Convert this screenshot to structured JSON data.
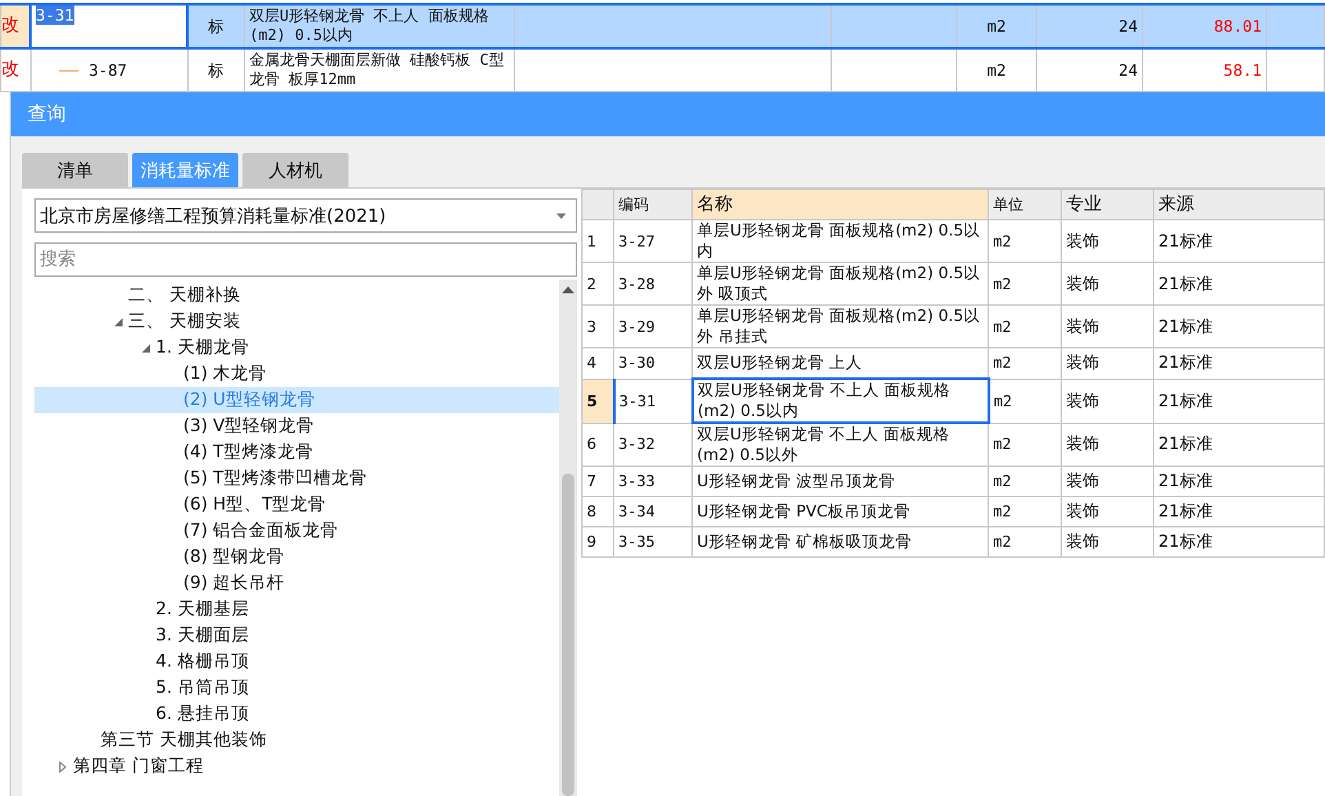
{
  "background_table": {
    "rows": [
      {
        "mark": "改",
        "code": "3-31",
        "type": "标",
        "name": "双层U形轻钢龙骨 不上人 面板规格(m2) 0.5以内",
        "unit": "m2",
        "quantity": "24",
        "price": "88.01",
        "selected": true
      },
      {
        "mark": "改",
        "code": "3-87",
        "type": "标",
        "name": "金属龙骨天棚面层新做 硅酸钙板 C型龙骨 板厚12mm",
        "unit": "m2",
        "quantity": "24",
        "price": "58.1",
        "selected": false
      }
    ]
  },
  "dialog": {
    "title": "查询",
    "tabs": [
      {
        "label": "清单",
        "selected": false
      },
      {
        "label": "消耗量标准",
        "selected": true
      },
      {
        "label": "人材机",
        "selected": false
      }
    ],
    "standard_dropdown": {
      "value": "北京市房屋修缮工程预算消耗量标准(2021)"
    },
    "search": {
      "placeholder": "搜索"
    },
    "tree": [
      {
        "children": [
          {
            "children": [
              {
                "label": "二、 天棚补换",
                "selected": false
              },
              {
                "label": "三、 天棚安装",
                "selected": false,
                "expanded": true,
                "children": [
                  {
                    "label": "1. 天棚龙骨",
                    "selected": false,
                    "expanded": true,
                    "children": [
                      {
                        "label": "(1) 木龙骨",
                        "selected": false
                      },
                      {
                        "label": "(2) U型轻钢龙骨",
                        "selected": true
                      },
                      {
                        "label": "(3) V型轻钢龙骨",
                        "selected": false
                      },
                      {
                        "label": "(4) T型烤漆龙骨",
                        "selected": false
                      },
                      {
                        "label": "(5) T型烤漆带凹槽龙骨",
                        "selected": false
                      },
                      {
                        "label": "(6) H型、T型龙骨",
                        "selected": false
                      },
                      {
                        "label": "(7) 铝合金面板龙骨",
                        "selected": false
                      },
                      {
                        "label": "(8) 型钢龙骨",
                        "selected": false
                      },
                      {
                        "label": "(9) 超长吊杆",
                        "selected": false
                      }
                    ]
                  },
                  {
                    "label": "2. 天棚基层",
                    "selected": false
                  },
                  {
                    "label": "3. 天棚面层",
                    "selected": false
                  },
                  {
                    "label": "4. 格栅吊顶",
                    "selected": false
                  },
                  {
                    "label": "5. 吊筒吊顶",
                    "selected": false
                  },
                  {
                    "label": "6. 悬挂吊顶",
                    "selected": false
                  }
                ]
              }
            ]
          },
          {
            "label": "第三节 天棚其他装饰",
            "selected": false
          }
        ]
      },
      {
        "label": "第四章 门窗工程",
        "selected": false,
        "expanded": false
      }
    ],
    "grid": {
      "columns": [
        {
          "label": "编码",
          "selected": false
        },
        {
          "label": "名称",
          "selected": true
        },
        {
          "label": "单位",
          "selected": false
        },
        {
          "label": "专业",
          "selected": false
        },
        {
          "label": "来源",
          "selected": false
        }
      ],
      "rows": [
        {
          "index": "1",
          "code": "3-27",
          "name": "单层U形轻钢龙骨 面板规格(m2) 0.5以内",
          "unit": "m2",
          "major": "装饰",
          "source": "21标准",
          "selected": false
        },
        {
          "index": "2",
          "code": "3-28",
          "name": "单层U形轻钢龙骨 面板规格(m2) 0.5以外 吸顶式",
          "unit": "m2",
          "major": "装饰",
          "source": "21标准",
          "selected": false
        },
        {
          "index": "3",
          "code": "3-29",
          "name": "单层U形轻钢龙骨 面板规格(m2) 0.5以外 吊挂式",
          "unit": "m2",
          "major": "装饰",
          "source": "21标准",
          "selected": false
        },
        {
          "index": "4",
          "code": "3-30",
          "name": "双层U形轻钢龙骨 上人",
          "unit": "m2",
          "major": "装饰",
          "source": "21标准",
          "selected": false
        },
        {
          "index": "5",
          "code": "3-31",
          "name": "双层U形轻钢龙骨 不上人 面板规格(m2) 0.5以内",
          "unit": "m2",
          "major": "装饰",
          "source": "21标准",
          "selected": true
        },
        {
          "index": "6",
          "code": "3-32",
          "name": "双层U形轻钢龙骨 不上人 面板规格(m2) 0.5以外",
          "unit": "m2",
          "major": "装饰",
          "source": "21标准",
          "selected": false
        },
        {
          "index": "7",
          "code": "3-33",
          "name": "U形轻钢龙骨 波型吊顶龙骨",
          "unit": "m2",
          "major": "装饰",
          "source": "21标准",
          "selected": false
        },
        {
          "index": "8",
          "code": "3-34",
          "name": "U形轻钢龙骨 PVC板吊顶龙骨",
          "unit": "m2",
          "major": "装饰",
          "source": "21标准",
          "selected": false
        },
        {
          "index": "9",
          "code": "3-35",
          "name": "U形轻钢龙骨 矿棉板吸顶龙骨",
          "unit": "m2",
          "major": "装饰",
          "source": "21标准",
          "selected": false
        }
      ]
    }
  }
}
